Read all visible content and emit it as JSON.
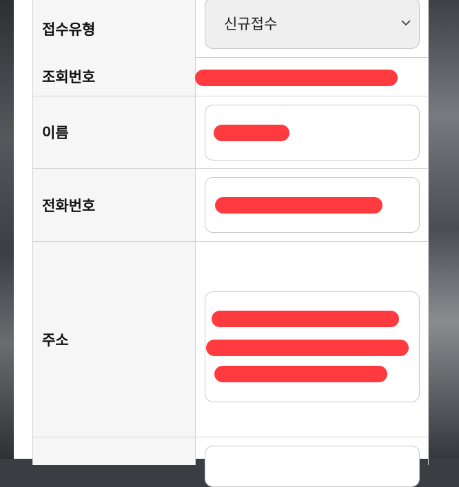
{
  "form": {
    "reception_type": {
      "label": "접수유형",
      "selected": "신규접수"
    },
    "lookup_number": {
      "label": "조회번호",
      "value": ""
    },
    "name": {
      "label": "이름",
      "value": ""
    },
    "phone": {
      "label": "전화번호",
      "value": ""
    },
    "address": {
      "label": "주소",
      "value": ""
    }
  },
  "redaction_color": "#ff3b3f",
  "icons": {
    "select_chevron": "chevron-down-icon"
  }
}
